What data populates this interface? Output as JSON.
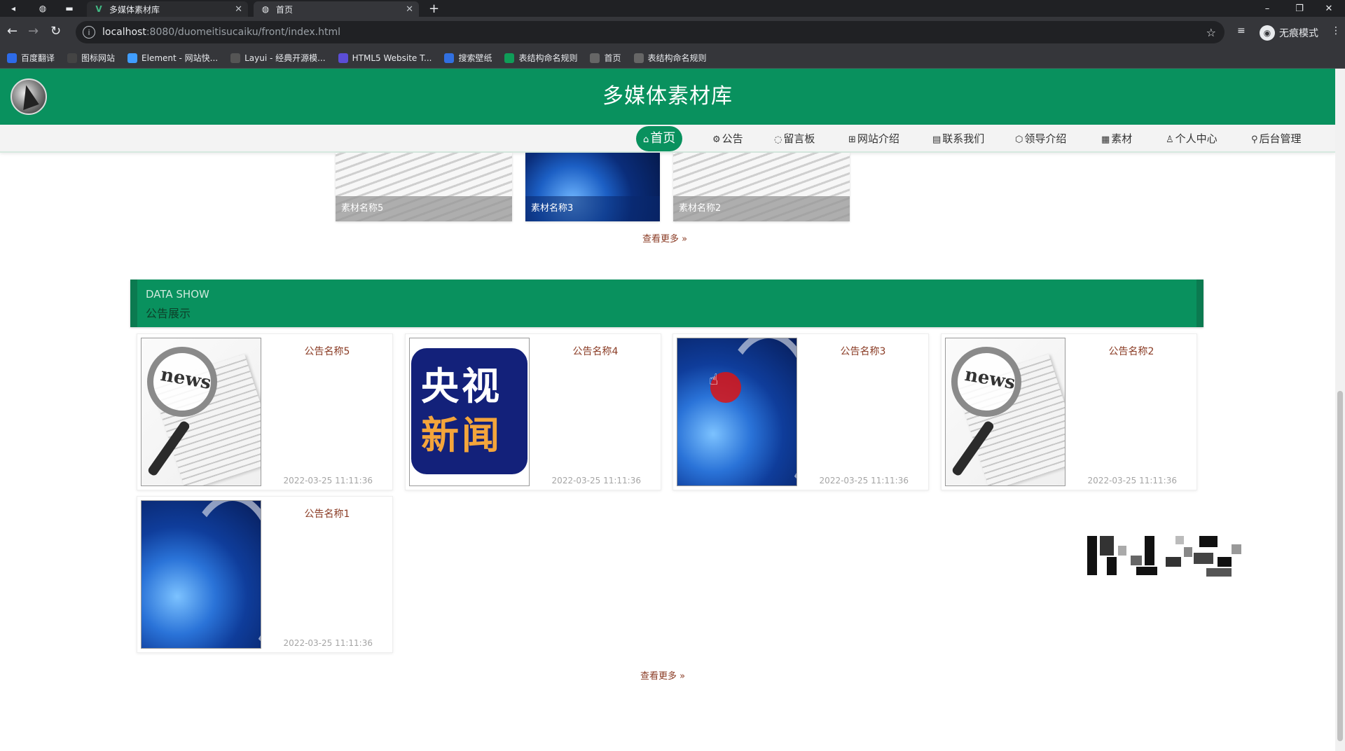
{
  "browser": {
    "tabs": [
      {
        "title": "多媒体素材库",
        "active": false,
        "icon": "vue-logo-icon"
      },
      {
        "title": "首页",
        "active": true,
        "icon": "globe-icon"
      }
    ],
    "url_host": "localhost",
    "url_path": ":8080/duomeitisucaiku/front/index.html",
    "profile_label": "无痕模式",
    "bookmarks": [
      {
        "label": "百度翻译",
        "color": "#2d6be8"
      },
      {
        "label": "图标网站",
        "color": "#444444"
      },
      {
        "label": "Element - 网站快...",
        "color": "#409eff"
      },
      {
        "label": "Layui - 经典开源模...",
        "color": "#555555"
      },
      {
        "label": "HTML5 Website T...",
        "color": "#5b4dd6"
      },
      {
        "label": "搜索壁纸",
        "color": "#3170e0"
      },
      {
        "label": "表结构命名规则",
        "color": "#0f9d58"
      },
      {
        "label": "首页",
        "color": "#666666"
      },
      {
        "label": "表结构命名规则",
        "color": "#666666"
      }
    ]
  },
  "site": {
    "title": "多媒体素材库",
    "brand_color": "#09915e",
    "nav": [
      {
        "label": "首页",
        "icon": "home-icon",
        "glyph": "⌂",
        "active": true
      },
      {
        "label": "公告",
        "icon": "gear-icon",
        "glyph": "⚙",
        "active": false
      },
      {
        "label": "留言板",
        "icon": "message-icon",
        "glyph": "◌",
        "active": false
      },
      {
        "label": "网站介绍",
        "icon": "grid-icon",
        "glyph": "⊞",
        "active": false
      },
      {
        "label": "联系我们",
        "icon": "contact-icon",
        "glyph": "▤",
        "active": false
      },
      {
        "label": "领导介绍",
        "icon": "cube-icon",
        "glyph": "⬡",
        "active": false
      },
      {
        "label": "素材",
        "icon": "image-icon",
        "glyph": "▦",
        "active": false
      },
      {
        "label": "个人中心",
        "icon": "user-icon",
        "glyph": "♙",
        "active": false
      },
      {
        "label": "后台管理",
        "icon": "link-icon",
        "glyph": "⚲",
        "active": false
      }
    ]
  },
  "materials": {
    "items": [
      {
        "caption": "素材名称5",
        "image": "news-image"
      },
      {
        "caption": "素材名称3",
        "image": "globe-broadcast-image"
      },
      {
        "caption": "素材名称2",
        "image": "news-image"
      }
    ],
    "more_label": "查看更多"
  },
  "notices": {
    "section_en": "DATA SHOW",
    "section_cn": "公告展示",
    "items": [
      {
        "title": "公告名称5",
        "time": "2022-03-25 11:11:36",
        "image": "news-image"
      },
      {
        "title": "公告名称4",
        "time": "2022-03-25 11:11:36",
        "image": "cctv-news-image",
        "image_text_1": "央视",
        "image_text_2": "新闻"
      },
      {
        "title": "公告名称3",
        "time": "2022-03-25 11:11:36",
        "image": "globe-broadcast-image"
      },
      {
        "title": "公告名称2",
        "time": "2022-03-25 11:11:36",
        "image": "news-image"
      },
      {
        "title": "公告名称1",
        "time": "2022-03-25 11:11:36",
        "image": "globe-broadcast-image"
      }
    ],
    "more_label": "查看更多",
    "news_logo_text": "news"
  }
}
